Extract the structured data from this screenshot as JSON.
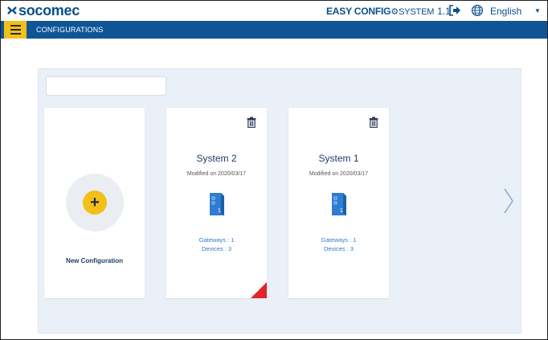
{
  "header": {
    "brand": "socomec",
    "product_bold": "EASY CONFIG",
    "product_light": "SYSTEM",
    "version": "1.1",
    "language": "English",
    "icons": [
      "logout-icon",
      "globe-icon",
      "chevron-down-icon"
    ]
  },
  "nav": {
    "title": "CONFIGURATIONS",
    "menu_icon": "hamburger-menu-icon"
  },
  "search": {
    "value": "",
    "placeholder": ""
  },
  "new_card": {
    "label": "New Configuration",
    "icon": "plus-icon"
  },
  "configurations": [
    {
      "name": "System 2",
      "modified": "Modified on 2020/03/17",
      "gateways": "Gateways : 1",
      "devices": "Devices : 3",
      "flagged": true
    },
    {
      "name": "System 1",
      "modified": "Modified on 2020/03/17",
      "gateways": "Gateways : 1",
      "devices": "Devices : 3",
      "flagged": false
    }
  ],
  "colors": {
    "brand_blue": "#0f5596",
    "accent_yellow": "#f3c018",
    "panel_bg": "#eaf0f7",
    "link_blue": "#2e7dd0",
    "flag_red": "#e3232b"
  }
}
